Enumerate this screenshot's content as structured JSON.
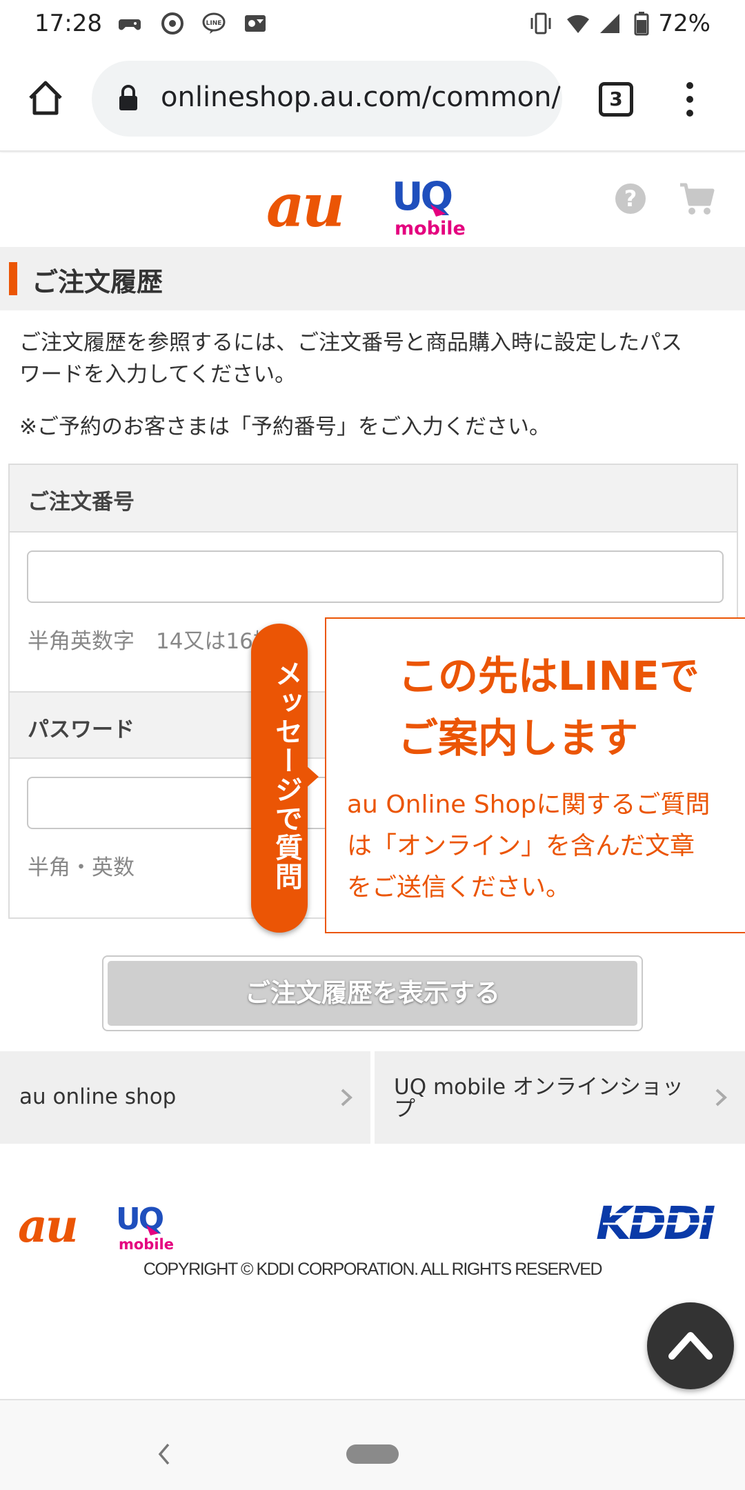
{
  "status_bar": {
    "time": "17:28",
    "battery": "72%",
    "icons": [
      "game-controller-icon",
      "notification-icon",
      "line-icon",
      "outlook-icon",
      "vibrate-icon",
      "wifi-icon",
      "signal-icon",
      "battery-icon"
    ]
  },
  "browser": {
    "url": "onlineshop.au.com/common/",
    "tab_count": "3",
    "icons": [
      "home-icon",
      "lock-icon",
      "overflow-menu-icon"
    ]
  },
  "header": {
    "logo_au": "au",
    "logo_uq": "UQ",
    "logo_mobile": "mobile",
    "icons": [
      "help-icon",
      "cart-icon"
    ]
  },
  "page": {
    "title": "ご注文履歴",
    "intro_line1": "ご注文履歴を参照するには、ご注文番号と商品購入時に設定したパス",
    "intro_line2": "ワードを入力してください。",
    "note": "※ご予約のお客さまは「予約番号」をご入力ください。"
  },
  "form": {
    "order_number_label": "ご注文番号",
    "order_number_value": "",
    "order_number_hint": "半角英数字　14又は16桁",
    "password_label": "パスワード",
    "password_value": "",
    "password_hint": "半角・英数"
  },
  "line_popup": {
    "tab_label": "メッセージで質問",
    "heading_line1": "この先はLINEで",
    "heading_line2": "ご案内します",
    "body_line1": "au Online Shopに関するご質問",
    "body_line2": "は「オンライン」を含んだ文章",
    "body_line3": "をご送信ください。"
  },
  "submit": {
    "label": "ご注文履歴を表示する"
  },
  "shop_links": {
    "au_label": "au online shop",
    "uq_label_line1": "UQ mobile オンラインショッ",
    "uq_label_line2": "プ"
  },
  "footer": {
    "logo_au": "au",
    "logo_uq": "UQ",
    "logo_mobile": "mobile",
    "kddi_logo": "KDDI",
    "copyright": "COPYRIGHT © KDDI CORPORATION. ALL RIGHTS RESERVED"
  },
  "colors": {
    "accent": "#eb5505",
    "uq_blue": "#1f4fbd",
    "uq_magenta": "#e4007f",
    "kddi_blue": "#0a3aa8"
  }
}
